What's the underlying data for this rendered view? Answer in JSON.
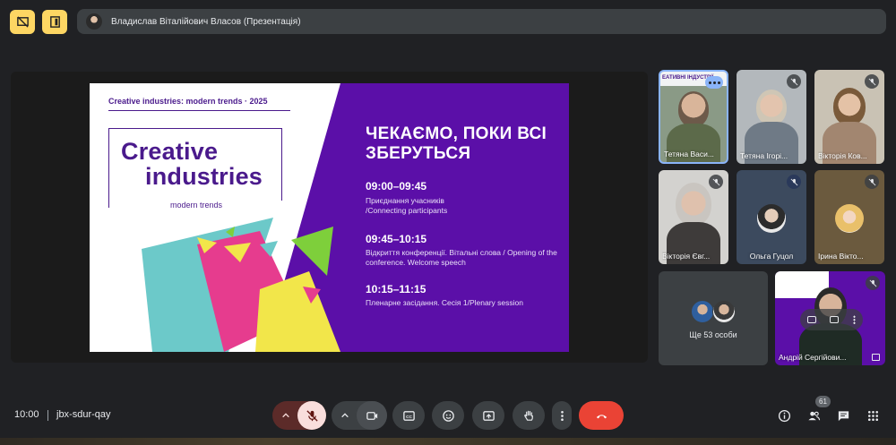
{
  "colors": {
    "background": "#202124",
    "accent_yellow": "#fdd663",
    "slide_purple": "#5b0fa8",
    "hangup_red": "#ea4335",
    "mic_off_bg": "#f9dedc"
  },
  "top_bar": {
    "presenter_label": "Владислав Віталійович Власов (Презентація)"
  },
  "slide": {
    "header": "Creative industries: modern trends  ·  2025",
    "logo_line1": "Creative",
    "logo_line2": "industries",
    "logo_subtitle": "modern trends",
    "title": "ЧЕКАЄМО, ПОКИ ВСІ ЗБЕРУТЬСЯ",
    "schedule": [
      {
        "time": "09:00–09:45",
        "text": "Приєднання учасників /Connecting participants"
      },
      {
        "time": "09:45–10:15",
        "text": "Відкриття конференції. Вітальні слова / Opening of the conference. Welcome speech"
      },
      {
        "time": "10:15–11:15",
        "text": "Пленарне засідання. Сесія 1/Plenary session"
      }
    ]
  },
  "participants": [
    {
      "name": "Тетяна Васи...",
      "banner": "ЕАТИВНІ ІНДУСТРІЇ",
      "has_more_menu": true
    },
    {
      "name": "Тетяна Ігорі..."
    },
    {
      "name": "Вікторія Ков..."
    },
    {
      "name": "Вікторія Євг..."
    },
    {
      "name": "Ольга Гуцол"
    },
    {
      "name": "Ірина Вікто..."
    },
    {
      "name": "Андрій Сергійови..."
    }
  ],
  "others": {
    "label": "Ще 53 особи"
  },
  "bottom_bar": {
    "clock": "10:00",
    "meeting_code": "jbx-sdur-qay",
    "participant_count": "61"
  },
  "icons": {
    "present": "present-icon",
    "more": "more-vert-icon",
    "hangup": "call-end-icon"
  }
}
